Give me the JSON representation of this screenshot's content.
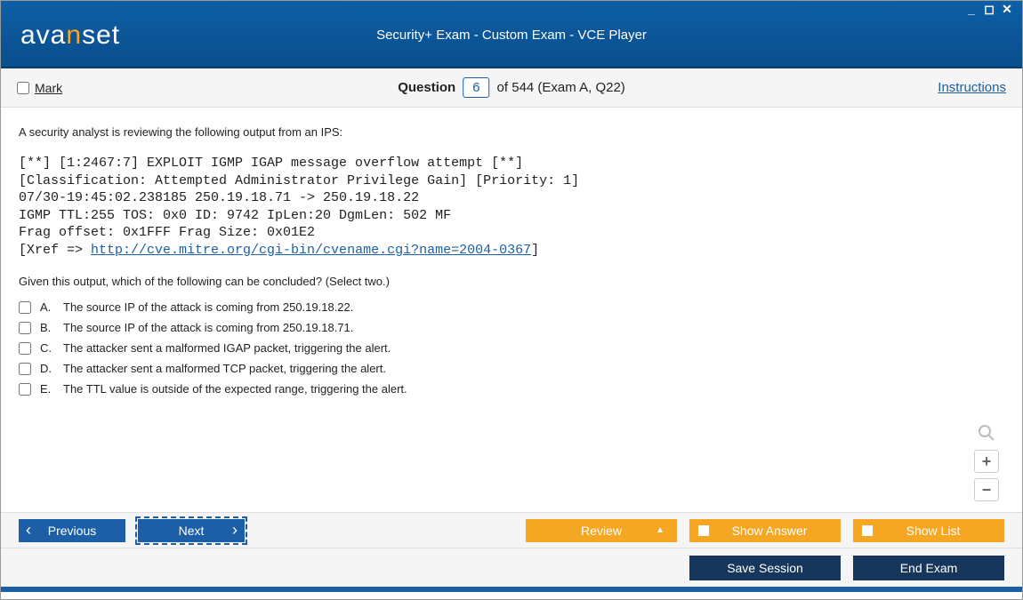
{
  "window": {
    "logo_pre": "ava",
    "logo_mid": "n",
    "logo_post": "set",
    "title": "Security+ Exam - Custom Exam - VCE Player"
  },
  "infobar": {
    "mark_label": "Mark",
    "question_word": "Question",
    "question_num": "6",
    "of_text": "of 544 (Exam A, Q22)",
    "instructions": "Instructions"
  },
  "question": {
    "prompt1": "A security analyst is reviewing the following output from an IPS:",
    "ips_line1": "[**] [1:2467:7] EXPLOIT IGMP IGAP message overflow attempt [**]",
    "ips_line2": "[Classification: Attempted Administrator Privilege Gain] [Priority: 1]",
    "ips_line3": "07/30-19:45:02.238185 250.19.18.71 -> 250.19.18.22",
    "ips_line4": "IGMP TTL:255 TOS: 0x0 ID: 9742 IpLen:20 DgmLen: 502 MF",
    "ips_line5": "Frag offset: 0x1FFF Frag Size: 0x01E2",
    "ips_line6_pre": "[Xref => ",
    "ips_link": "http://cve.mitre.org/cgi-bin/cvename.cgi?name=2004-0367",
    "ips_line6_post": "]",
    "prompt2": "Given this output, which of the following can be concluded? (Select two.)",
    "choices": [
      {
        "letter": "A.",
        "text": "The source IP of the attack is coming from 250.19.18.22."
      },
      {
        "letter": "B.",
        "text": "The source IP of the attack is coming from 250.19.18.71."
      },
      {
        "letter": "C.",
        "text": "The attacker sent a malformed IGAP packet, triggering the alert."
      },
      {
        "letter": "D.",
        "text": "The attacker sent a malformed TCP packet, triggering the alert."
      },
      {
        "letter": "E.",
        "text": "The TTL value is outside of the expected range, triggering the alert."
      }
    ]
  },
  "nav": {
    "previous": "Previous",
    "next": "Next",
    "review": "Review",
    "show_answer": "Show Answer",
    "show_list": "Show List"
  },
  "bottom": {
    "save_session": "Save Session",
    "end_exam": "End Exam"
  }
}
